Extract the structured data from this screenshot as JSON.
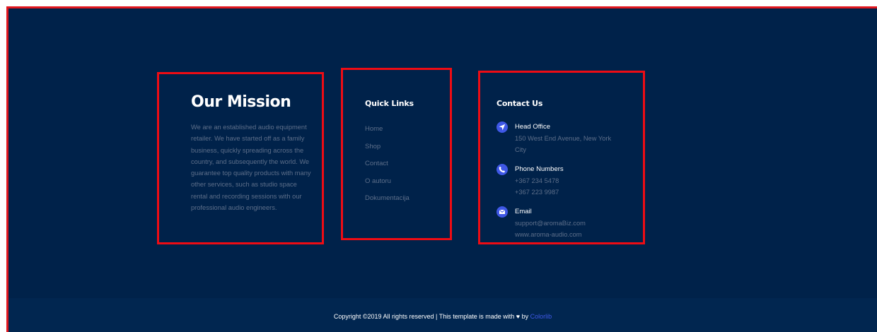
{
  "mission": {
    "title": "Our Mission",
    "text": "We are an established audio equipment retailer. We have started off as a family business, quickly spreading across the country, and subsequently the world. We guarantee top quality products with many other services, such as studio space rental and recording sessions with our professional audio engineers."
  },
  "quick_links": {
    "title": "Quick Links",
    "items": [
      {
        "label": "Home"
      },
      {
        "label": "Shop"
      },
      {
        "label": "Contact"
      },
      {
        "label": "O autoru"
      },
      {
        "label": "Dokumentacija"
      }
    ]
  },
  "contact": {
    "title": "Contact Us",
    "office": {
      "label": "Head Office",
      "line1": "150 West End Avenue, New York",
      "line2": "City",
      "icon": "location-arrow-icon"
    },
    "phone": {
      "label": "Phone Numbers",
      "line1": "+367 234 5478",
      "line2": "+367 223 9987",
      "icon": "phone-icon"
    },
    "email": {
      "label": "Email",
      "line1": "support@aromaBiz.com",
      "line2": "www.aroma-audio.com",
      "icon": "envelope-icon"
    }
  },
  "footer": {
    "copyright_prefix": "Copyright ©2019 All rights reserved | This template is made with",
    "heart": "♥",
    "by": "by",
    "brand_link": "Colorlib"
  },
  "colors": {
    "background": "#00224a",
    "accent": "#3f58e6",
    "highlight_border": "#ee0c14",
    "muted_text": "#5d6f8a"
  }
}
